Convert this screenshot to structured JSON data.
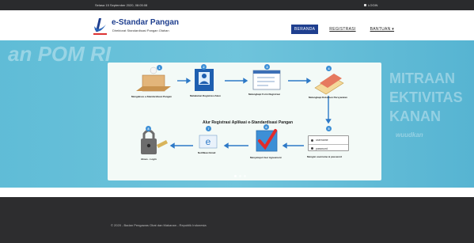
{
  "topbar": {
    "datetime": "Selasa 15 September 2020, 08:05:08",
    "login_label": "LOGIN"
  },
  "header": {
    "title": "e-Standar Pangan",
    "subtitle": "Direktorat Standardisasi Pangan Olahan",
    "logo_text": "BADAN POM"
  },
  "nav": {
    "items": [
      {
        "label": "BERANDA",
        "active": true
      },
      {
        "label": "REGISTRASI",
        "active": false
      },
      {
        "label": "BANTUAN ▾",
        "active": false
      }
    ]
  },
  "hero": {
    "watermark_left": "an POM RI",
    "watermark_right": [
      "MITRAAN",
      "EKTIVITAS",
      "KANAN",
      "wuudkan"
    ],
    "flow": {
      "title": "Alur Registrasi Aplikasi e-Standardisasi Pangan",
      "steps": [
        {
          "num": "1",
          "label": "Mengakses e-Standardisasi Pangan"
        },
        {
          "num": "2",
          "label": "Melakukan Registrasi Akun"
        },
        {
          "num": "3",
          "label": "Melengkapi Form Registrasi"
        },
        {
          "num": "4",
          "label": "Melengkapi Dokumen Persyaratan"
        },
        {
          "num": "5",
          "label": "Mengisi username & password"
        },
        {
          "num": "6",
          "label": "Menyetujui User Agreement"
        },
        {
          "num": "7",
          "label": "Notifikasi Email"
        },
        {
          "num": "8",
          "label": "Akses - Login"
        }
      ],
      "credentials": {
        "username": "username",
        "password": "password"
      }
    },
    "slides": 3,
    "active_slide": 1
  },
  "footer": {
    "copyright": "© 2020 - Badan Pengawas Obat dan Makanan - Republik Indonesia"
  }
}
